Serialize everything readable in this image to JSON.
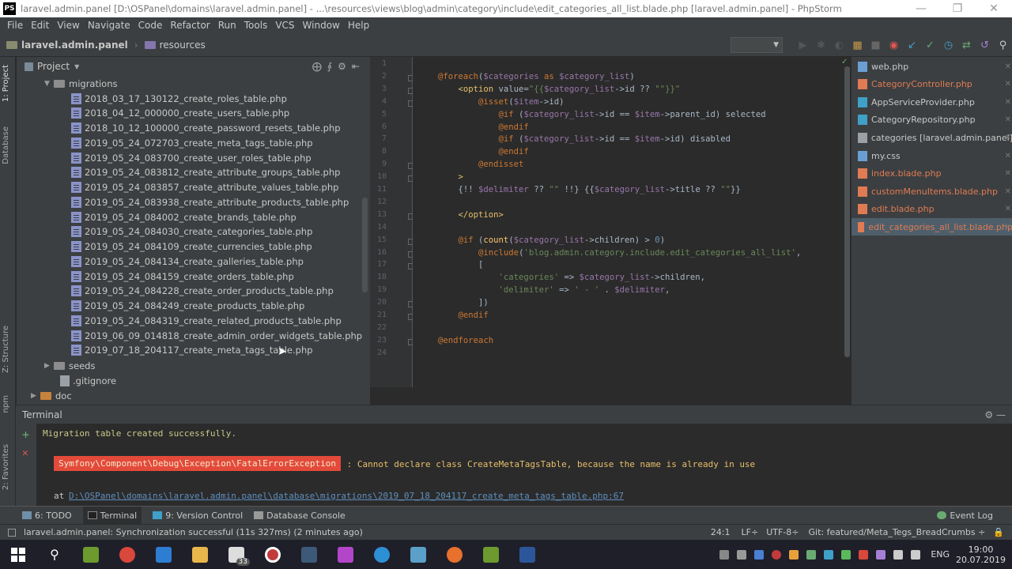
{
  "window": {
    "title": "laravel.admin.panel [D:\\OSPanel\\domains\\laravel.admin.panel] - ...\\resources\\views\\blog\\admin\\category\\include\\edit_categories_all_list.blade.php [laravel.admin.panel] - PhpStorm",
    "app_icon": "PS"
  },
  "menu": [
    "File",
    "Edit",
    "View",
    "Navigate",
    "Code",
    "Refactor",
    "Run",
    "Tools",
    "VCS",
    "Window",
    "Help"
  ],
  "breadcrumb": {
    "project": "laravel.admin.panel",
    "folder": "resources"
  },
  "left_strip": {
    "project": "1: Project",
    "database": "Database",
    "structure": "Z: Structure",
    "npm": "npm",
    "favorites": "2: Favorites"
  },
  "project_panel": {
    "title": "Project",
    "folder": "migrations",
    "files": [
      "2018_03_17_130122_create_roles_table.php",
      "2018_04_12_000000_create_users_table.php",
      "2018_10_12_100000_create_password_resets_table.php",
      "2019_05_24_072703_create_meta_tags_table.php",
      "2019_05_24_083700_create_user_roles_table.php",
      "2019_05_24_083812_create_attribute_groups_table.php",
      "2019_05_24_083857_create_attribute_values_table.php",
      "2019_05_24_083938_create_attribute_products_table.php",
      "2019_05_24_084002_create_brands_table.php",
      "2019_05_24_084030_create_categories_table.php",
      "2019_05_24_084109_create_currencies_table.php",
      "2019_05_24_084134_create_galleries_table.php",
      "2019_05_24_084159_create_orders_table.php",
      "2019_05_24_084228_create_order_products_table.php",
      "2019_05_24_084249_create_products_table.php",
      "2019_05_24_084319_create_related_products_table.php",
      "2019_06_09_014818_create_admin_order_widgets_table.php",
      "2019_07_18_204117_create_meta_tags_table.php"
    ],
    "seeds": "seeds",
    "gitignore": ".gitignore",
    "doc": "doc"
  },
  "editor": {
    "line_numbers": [
      "1",
      "2",
      "3",
      "4",
      "5",
      "6",
      "7",
      "8",
      "9",
      "10",
      "11",
      "12",
      "13",
      "14",
      "15",
      "16",
      "17",
      "18",
      "19",
      "20",
      "21",
      "22",
      "23",
      "24"
    ],
    "lines": [
      [],
      [
        [
          "kw",
          "@foreach"
        ],
        [
          "p",
          "("
        ],
        [
          "var",
          "$categories"
        ],
        [
          "kw",
          " as "
        ],
        [
          "var",
          "$category_list"
        ],
        [
          "p",
          ")"
        ]
      ],
      [
        [
          "p",
          "    "
        ],
        [
          "tag",
          "<option"
        ],
        [
          "p",
          " value="
        ],
        [
          "str",
          "\"{{"
        ],
        [
          "var",
          "$category_list"
        ],
        [
          "p",
          "->id ?? "
        ],
        [
          "str",
          "\"\""
        ],
        [
          "str",
          "}}\""
        ]
      ],
      [
        [
          "p",
          "        "
        ],
        [
          "kw",
          "@isset"
        ],
        [
          "p",
          "("
        ],
        [
          "var",
          "$item"
        ],
        [
          "p",
          "->id)"
        ]
      ],
      [
        [
          "p",
          "            "
        ],
        [
          "kw",
          "@if"
        ],
        [
          "p",
          " ("
        ],
        [
          "var",
          "$category_list"
        ],
        [
          "p",
          "->id == "
        ],
        [
          "var",
          "$item"
        ],
        [
          "p",
          "->parent_id) selected"
        ]
      ],
      [
        [
          "p",
          "            "
        ],
        [
          "kw",
          "@endif"
        ]
      ],
      [
        [
          "p",
          "            "
        ],
        [
          "kw",
          "@if"
        ],
        [
          "p",
          " ("
        ],
        [
          "var",
          "$category_list"
        ],
        [
          "p",
          "->id == "
        ],
        [
          "var",
          "$item"
        ],
        [
          "p",
          "->id) disabled"
        ]
      ],
      [
        [
          "p",
          "            "
        ],
        [
          "kw",
          "@endif"
        ]
      ],
      [
        [
          "p",
          "        "
        ],
        [
          "kw",
          "@endisset"
        ]
      ],
      [
        [
          "p",
          "    "
        ],
        [
          "tag",
          ">"
        ]
      ],
      [
        [
          "p",
          "    {!! "
        ],
        [
          "var",
          "$delimiter"
        ],
        [
          "p",
          " ?? "
        ],
        [
          "str",
          "\"\""
        ],
        [
          "p",
          " !!} {{"
        ],
        [
          "var",
          "$category_list"
        ],
        [
          "p",
          "->title ?? "
        ],
        [
          "str",
          "\"\""
        ],
        [
          "p",
          "}}"
        ]
      ],
      [],
      [
        [
          "p",
          "    "
        ],
        [
          "tag",
          "</option>"
        ]
      ],
      [],
      [
        [
          "p",
          "    "
        ],
        [
          "kw",
          "@if"
        ],
        [
          "p",
          " ("
        ],
        [
          "fn",
          "count"
        ],
        [
          "p",
          "("
        ],
        [
          "var",
          "$category_list"
        ],
        [
          "p",
          "->children) > "
        ],
        [
          "num",
          "0"
        ],
        [
          "p",
          ")"
        ]
      ],
      [
        [
          "p",
          "        "
        ],
        [
          "kw",
          "@include"
        ],
        [
          "p",
          "("
        ],
        [
          "str",
          "'blog.admin.category.include.edit_categories_all_list'"
        ],
        [
          "p",
          ","
        ]
      ],
      [
        [
          "p",
          "        ["
        ]
      ],
      [
        [
          "p",
          "            "
        ],
        [
          "str",
          "'categories'"
        ],
        [
          "p",
          " => "
        ],
        [
          "var",
          "$category_list"
        ],
        [
          "p",
          "->children,"
        ]
      ],
      [
        [
          "p",
          "            "
        ],
        [
          "str",
          "'delimiter'"
        ],
        [
          "p",
          " => "
        ],
        [
          "str",
          "' - '"
        ],
        [
          "p",
          " . "
        ],
        [
          "var",
          "$delimiter"
        ],
        [
          "p",
          ","
        ]
      ],
      [
        [
          "p",
          "        ])"
        ]
      ],
      [
        [
          "p",
          "    "
        ],
        [
          "kw",
          "@endif"
        ]
      ],
      [],
      [
        [
          "kw",
          "@endforeach"
        ]
      ],
      []
    ]
  },
  "tabs": [
    {
      "label": "web.php",
      "color": "#6a9fd4",
      "label_color": "#c8c8c8"
    },
    {
      "label": "CategoryController.php",
      "color": "#e07b53",
      "label_color": "#e07b53"
    },
    {
      "label": "AppServiceProvider.php",
      "color": "#3fa0c8",
      "label_color": "#c8c8c8"
    },
    {
      "label": "CategoryRepository.php",
      "color": "#3fa0c8",
      "label_color": "#c8c8c8"
    },
    {
      "label": "categories [laravel.admin.panel]",
      "color": "#9aa0a6",
      "label_color": "#c8c8c8"
    },
    {
      "label": "my.css",
      "color": "#6a9fd4",
      "label_color": "#c8c8c8"
    },
    {
      "label": "index.blade.php",
      "color": "#e07b53",
      "label_color": "#e07b53"
    },
    {
      "label": "customMenuItems.blade.php",
      "color": "#e07b53",
      "label_color": "#e07b53"
    },
    {
      "label": "edit.blade.php",
      "color": "#e07b53",
      "label_color": "#e07b53"
    },
    {
      "label": "edit_categories_all_list.blade.php",
      "color": "#e07b53",
      "label_color": "#e07b53"
    }
  ],
  "terminal": {
    "title": "Terminal",
    "line1": "Migration table created successfully.",
    "exception": "Symfony\\Component\\Debug\\Exception\\FatalErrorException",
    "error": " : Cannot declare class CreateMetaTagsTable, because the name is already in use",
    "at": "at ",
    "path": "D:\\OSPanel\\domains\\laravel.admin.panel\\database\\migrations\\2019_07_18_204117_create_meta_tags_table.php:67"
  },
  "bottom_tabs": {
    "todo": "6: TODO",
    "terminal": "Terminal",
    "vcs": "9: Version Control",
    "db": "Database Console",
    "event": "Event Log"
  },
  "status": {
    "left": "laravel.admin.panel: Synchronization successful (11s 327ms) (2 minutes ago)",
    "pos": "24:1",
    "lf": "LF÷",
    "enc": "UTF-8÷",
    "git": "Git: featured/Meta_Tegs_BreadCrumbs ÷"
  },
  "taskbar": {
    "lang": "ENG",
    "time": "19:00",
    "date": "20.07.2019",
    "badge": "33"
  }
}
